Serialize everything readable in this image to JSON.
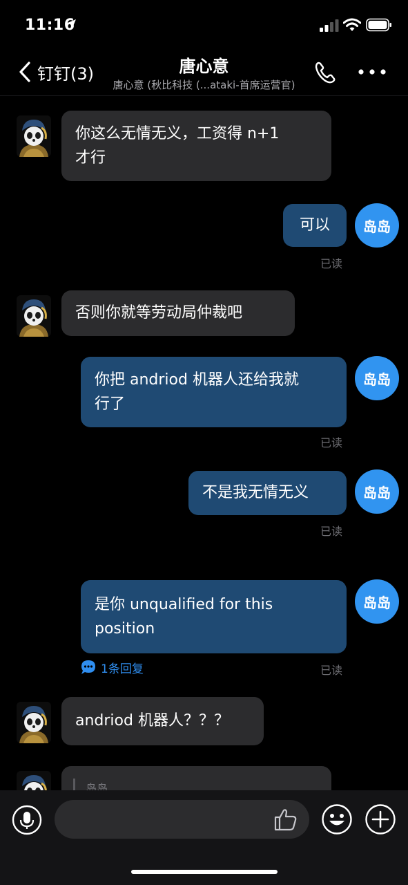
{
  "status_bar": {
    "time": "11:16"
  },
  "header": {
    "back_label": "钉钉(3)",
    "title": "唐心意",
    "subtitle": "唐心意 (秋比科技 (...ataki-首席运营官)"
  },
  "me_avatar_text": "岛岛",
  "read_label": "已读",
  "messages": [
    {
      "from": "other",
      "text_lines": [
        "你这么无情无义，工资得 n+1",
        "才行"
      ]
    },
    {
      "from": "me",
      "text_lines": [
        "可以"
      ],
      "status": "已读"
    },
    {
      "from": "other",
      "text_lines": [
        "否则你就等劳动局仲裁吧"
      ]
    },
    {
      "from": "me",
      "text_lines": [
        "你把 andriod 机器人还给我就",
        "行了"
      ],
      "status": "已读"
    },
    {
      "from": "me",
      "text_lines": [
        "不是我无情无义"
      ],
      "status": "已读"
    },
    {
      "from": "me",
      "text_lines": [
        "是你 unqualified for this",
        "position"
      ],
      "status": "已读",
      "replies": "1条回复"
    },
    {
      "from": "other",
      "text_lines": [
        "andriod 机器人？？？"
      ]
    },
    {
      "from": "other",
      "quote_name": "岛岛"
    }
  ],
  "colors": {
    "background": "#000000",
    "incoming_bubble": "#2c2c2e",
    "outgoing_bubble": "#1f4a73",
    "avatar_blue": "#3194f0",
    "link_blue": "#2f8ef0"
  },
  "icons": [
    "location-arrow-icon",
    "signal-icon",
    "wifi-icon",
    "battery-icon",
    "chevron-left-icon",
    "phone-icon",
    "more-icon",
    "panda-avatar-icon",
    "reply-bubble-icon",
    "microphone-icon",
    "thumbs-up-icon",
    "emoji-icon",
    "plus-icon"
  ]
}
